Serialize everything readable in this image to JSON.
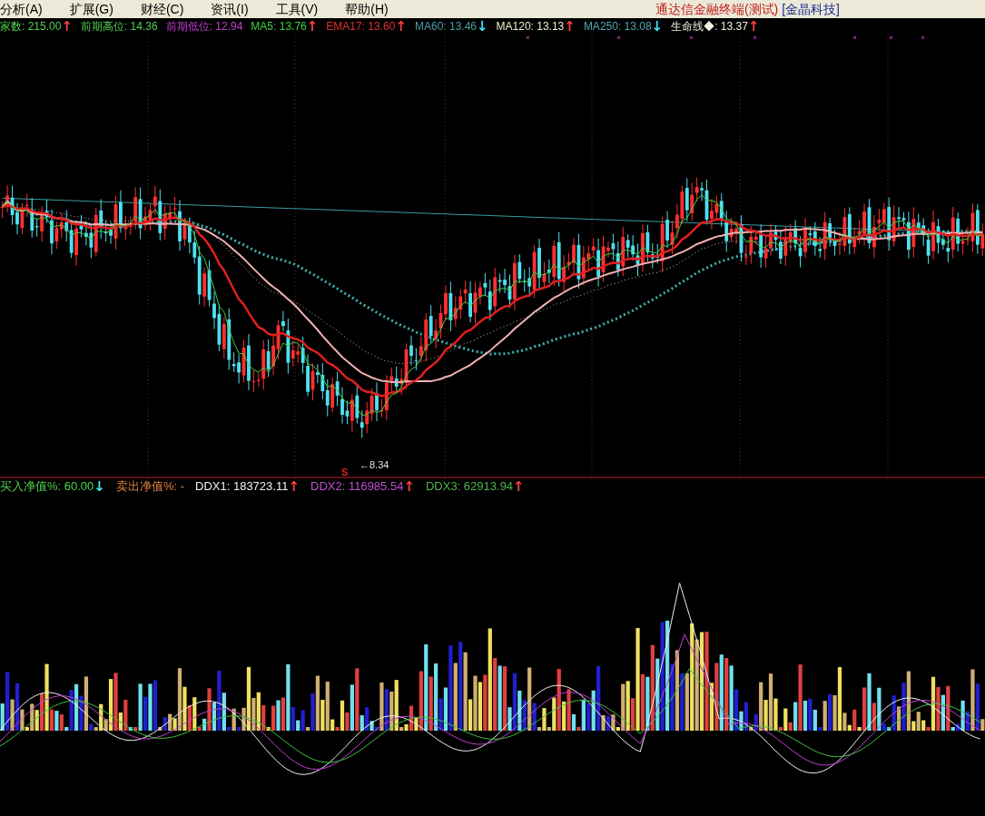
{
  "menu": [
    {
      "label": "分析(A)"
    },
    {
      "label": "扩展(G)"
    },
    {
      "label": "财经(C)"
    },
    {
      "label": "资讯(I)"
    },
    {
      "label": "工具(V)"
    },
    {
      "label": "帮助(H)"
    }
  ],
  "title": "通达信金融终端(测试)",
  "title_suffix": "[金晶科技]",
  "main_readouts": [
    {
      "label": "家数: 215.00",
      "color": "#50d050",
      "arrow": {
        "symbol": "↑",
        "color": "#ff4040"
      }
    },
    {
      "label": "前期高位: 14.36",
      "color": "#50d050"
    },
    {
      "label": "前期低位: 12.94",
      "color": "#c040d0"
    },
    {
      "label": "MA5: 13.76",
      "color": "#40d040",
      "arrow": {
        "symbol": "↑",
        "color": "#ff4040"
      }
    },
    {
      "label": "EMA17: 13.60",
      "color": "#e03030",
      "arrow": {
        "symbol": "↑",
        "color": "#ff4040"
      }
    },
    {
      "label": "MA60: 13.46",
      "color": "#4a9aa0",
      "arrow": {
        "symbol": "↓",
        "color": "#40e0f0"
      }
    },
    {
      "label": "MA120: 13.13",
      "color": "#f0f0d0",
      "arrow": {
        "symbol": "↑",
        "color": "#ff4040"
      }
    },
    {
      "label": "MA250: 13.08",
      "color": "#50a8b0",
      "arrow": {
        "symbol": "↓",
        "color": "#40e0f0"
      }
    },
    {
      "label": "生命线◆: 13.37",
      "color": "#f0f0e0",
      "arrow": {
        "symbol": "↑",
        "color": "#ff4040"
      }
    }
  ],
  "low_marker": "←8.34",
  "signal_marker": "S",
  "sub_readouts": [
    {
      "label": "买入净值%: 60.00",
      "color": "#50d050",
      "arrow": {
        "symbol": "↓",
        "color": "#40e0f0"
      }
    },
    {
      "label": "卖出净值%: -",
      "color": "#e08040"
    },
    {
      "label": "DDX1: 183723.11",
      "color": "#f0f0f0",
      "arrow": {
        "symbol": "↑",
        "color": "#ff4040"
      }
    },
    {
      "label": "DDX2: 116985.54",
      "color": "#c050d0",
      "arrow": {
        "symbol": "↑",
        "color": "#ff4040"
      }
    },
    {
      "label": "DDX3: 62913.94",
      "color": "#50b050",
      "arrow": {
        "symbol": "↑",
        "color": "#ff4040"
      }
    }
  ]
}
